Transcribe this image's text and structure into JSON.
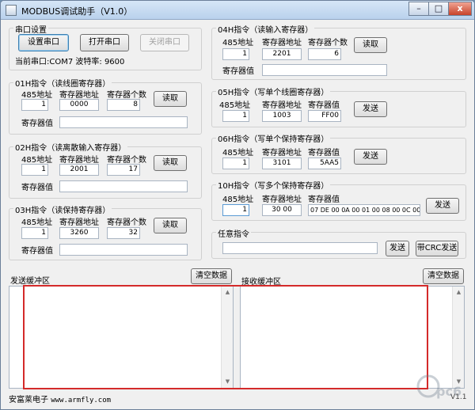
{
  "window": {
    "title": "MODBUS调试助手（V1.0）",
    "minimize": "–",
    "maximize": "□",
    "close": "x"
  },
  "serial": {
    "title": "串口设置",
    "setup_button": "设置串口",
    "open_button": "打开串口",
    "close_button": "关闭串口",
    "status": "当前串口:COM7 波特率: 9600"
  },
  "labels": {
    "addr485": "485地址",
    "reg_addr": "寄存器地址",
    "reg_count": "寄存器个数",
    "reg_value": "寄存器值",
    "read": "读取",
    "send": "发送"
  },
  "cmd01": {
    "title": "01H指令（读线圈寄存器）",
    "addr": "1",
    "reg_addr": "0000",
    "count": "8",
    "value": ""
  },
  "cmd02": {
    "title": "02H指令（读离散输入寄存器）",
    "addr": "1",
    "reg_addr": "2001",
    "count": "17",
    "value": ""
  },
  "cmd03": {
    "title": "03H指令（读保持寄存器）",
    "addr": "1",
    "reg_addr": "3260",
    "count": "32",
    "value": ""
  },
  "cmd04": {
    "title": "04H指令（读输入寄存器）",
    "addr": "1",
    "reg_addr": "2201",
    "count": "6",
    "value": ""
  },
  "cmd05": {
    "title": "05H指令（写单个线圈寄存器）",
    "addr": "1",
    "reg_addr": "1003",
    "value": "FF00"
  },
  "cmd06": {
    "title": "06H指令（写单个保持寄存器）",
    "addr": "1",
    "reg_addr": "3101",
    "value": "5AA5"
  },
  "cmd10": {
    "title": "10H指令（写多个保持寄存器）",
    "addr": "1",
    "reg_addr": "30 00",
    "value": "07 DE 00 0A 00 01 00 08 00 0C 00"
  },
  "custom": {
    "title": "任意指令",
    "value": "",
    "send_button": "发送",
    "crc_button": "带CRC发送"
  },
  "send_buffer": {
    "title": "发送缓冲区",
    "clear_button": "清空数据"
  },
  "recv_buffer": {
    "title": "接收缓冲区",
    "clear_button": "清空数据"
  },
  "footer": {
    "company": "安富莱电子",
    "url": "www.armfly.com"
  },
  "watermark": {
    "text": "pc6"
  },
  "version_fragment": "V1.1"
}
